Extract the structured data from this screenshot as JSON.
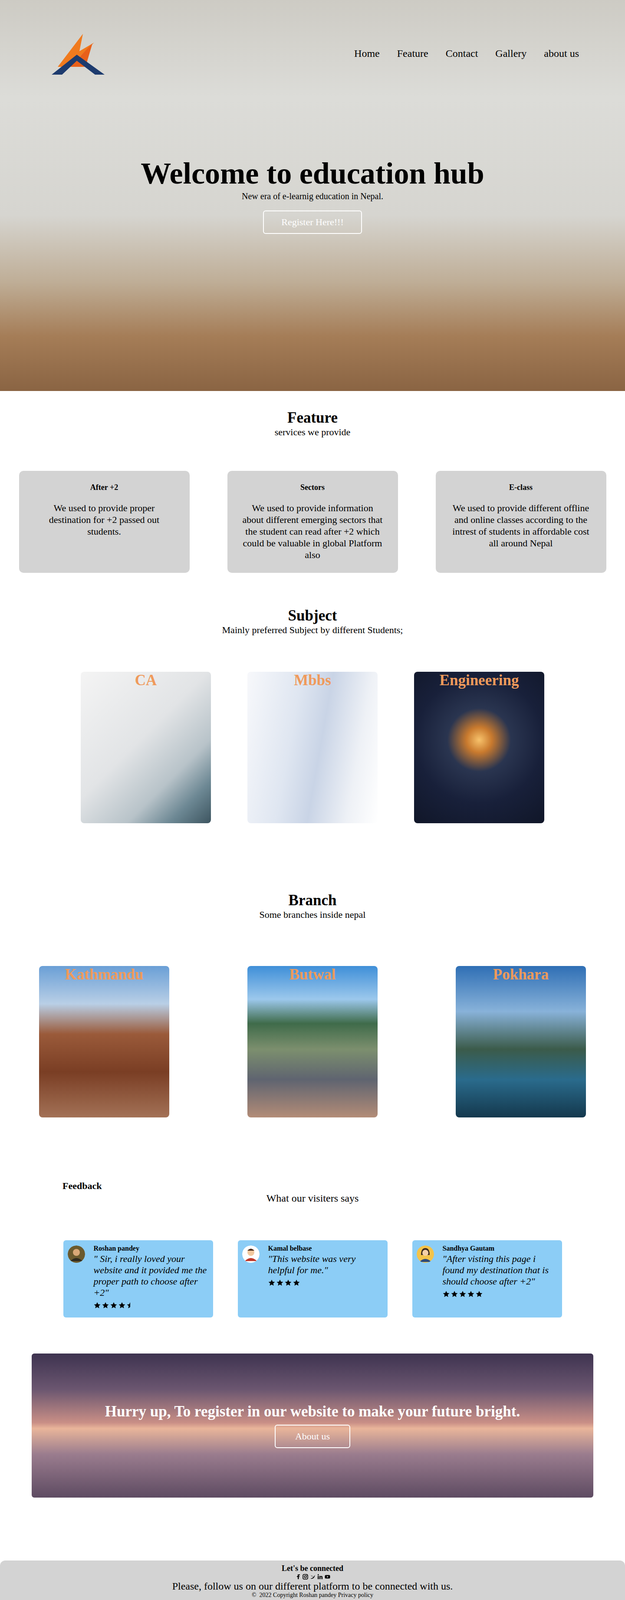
{
  "nav": {
    "items": [
      {
        "label": "Home"
      },
      {
        "label": "Feature"
      },
      {
        "label": "Contact"
      },
      {
        "label": "Gallery"
      },
      {
        "label": "about us"
      }
    ]
  },
  "hero": {
    "title": "Welcome to education hub",
    "subtitle": "New era of e-learnig education in Nepal.",
    "button": "Register Here!!!"
  },
  "features": {
    "title": "Feature",
    "subtitle": "services we provide",
    "cards": [
      {
        "title": "After +2",
        "text": "We used to provide proper destination for +2 passed out students."
      },
      {
        "title": "Sectors",
        "text": "We used to provide information about different emerging sectors that the student can read after +2 which could be valuable in global Platform also"
      },
      {
        "title": "E-class",
        "text": "We used to provide different offline and online classes according to the intrest of students in affordable cost all around Nepal"
      }
    ]
  },
  "subjects": {
    "title": "Subject",
    "subtitle": "Mainly preferred Subject by different Students;",
    "items": [
      {
        "label": "CA"
      },
      {
        "label": "Mbbs"
      },
      {
        "label": "Engineering"
      }
    ]
  },
  "branches": {
    "title": "Branch",
    "subtitle": "Some branches inside nepal",
    "items": [
      {
        "label": "Kathmandu"
      },
      {
        "label": "Butwal"
      },
      {
        "label": "Pokhara"
      }
    ]
  },
  "feedback": {
    "title": "Feedback",
    "subtitle": "What our visiters says",
    "reviews": [
      {
        "name": "Roshan pandey",
        "quote": "\" Sir, i really loved your website and it povided me the proper path to choose after +2\"",
        "stars": 4.5
      },
      {
        "name": "Kamal belbase",
        "quote": "\"This website was very helpful for me.\"",
        "stars": 4
      },
      {
        "name": "Sandhya Gautam",
        "quote": "\"After visting this page i found my destination that is should choose after +2\"",
        "stars": 5
      }
    ]
  },
  "cta": {
    "text": "Hurry up, To register in our website to make your future bright.",
    "button": "About us"
  },
  "footer": {
    "title": "Let's be connected",
    "text": "Please, follow us on our different platform to be connected with us.",
    "copyright": "©  2022 Copyright Roshan pandey Privacy policy"
  }
}
